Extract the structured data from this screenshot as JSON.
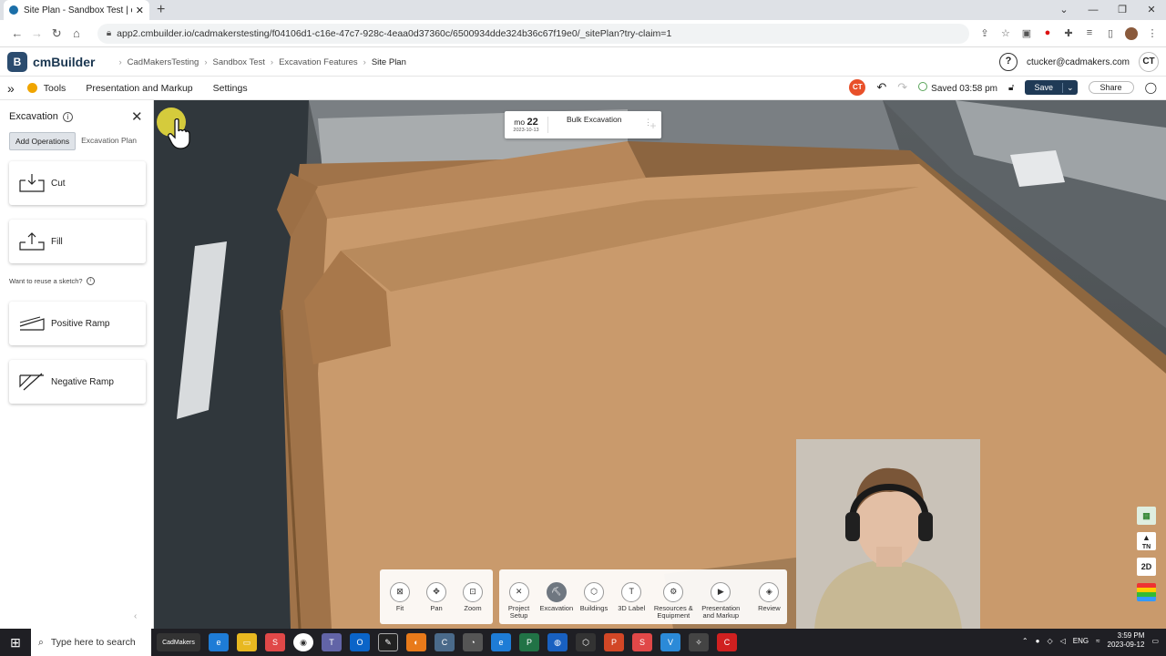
{
  "browser": {
    "tab_title": "Site Plan - Sandbox Test | cmBuil",
    "url": "app2.cmbuilder.io/cadmakerstesting/f04106d1-c16e-47c7-928c-4eaa0d37360c/6500934dde324b36c67f19e0/_sitePlan?try-claim=1"
  },
  "app": {
    "logo_text": "cmBuilder",
    "logo_mark": "B",
    "breadcrumbs": [
      "CadMakersTesting",
      "Sandbox Test",
      "Excavation Features",
      "Site Plan"
    ],
    "help_symbol": "?",
    "user_email": "ctucker@cadmakers.com",
    "user_initials": "CT"
  },
  "toolbar": {
    "tools_label": "Tools",
    "presentation_label": "Presentation and Markup",
    "settings_label": "Settings",
    "user_badge": "CT",
    "saved_status": "Saved 03:58 pm",
    "save_label": "Save",
    "share_label": "Share"
  },
  "sidebar": {
    "title": "Excavation",
    "tabs": [
      "Add Operations",
      "Excavation Plan"
    ],
    "operations": [
      {
        "label": "Cut",
        "icon": "cut-icon"
      },
      {
        "label": "Fill",
        "icon": "fill-icon"
      }
    ],
    "reuse_text": "Want to reuse a sketch?",
    "ramps": [
      {
        "label": "Positive Ramp",
        "icon": "positive-ramp-icon"
      },
      {
        "label": "Negative Ramp",
        "icon": "negative-ramp-icon"
      }
    ]
  },
  "timeline": {
    "weekday": "mo",
    "day": "22",
    "date": "2023-10-13",
    "phase": "Bulk Excavation"
  },
  "view_controls": [
    {
      "label": "Fit",
      "icon": "fit-icon"
    },
    {
      "label": "Pan",
      "icon": "pan-icon"
    },
    {
      "label": "Zoom",
      "icon": "zoom-icon"
    }
  ],
  "main_tools": [
    {
      "label": "Project\nSetup",
      "icon": "project-setup-icon",
      "active": false
    },
    {
      "label": "Excavation",
      "icon": "excavation-icon",
      "active": true
    },
    {
      "label": "Buildings",
      "icon": "buildings-icon",
      "active": false
    },
    {
      "label": "3D Label",
      "icon": "3d-label-icon",
      "active": false
    },
    {
      "label": "Resources &\nEquipment",
      "icon": "resources-icon",
      "active": false
    },
    {
      "label": "Presentation\nand Markup",
      "icon": "presentation-icon",
      "active": false
    },
    {
      "label": "Review",
      "icon": "review-icon",
      "active": false
    }
  ],
  "map_controls": {
    "north_label": "TN",
    "view_mode": "2D"
  },
  "taskbar": {
    "search_placeholder": "Type here to search",
    "pinned_app": "CadMakers",
    "language": "ENG",
    "time": "3:59 PM",
    "date": "2023-09-12"
  },
  "colors": {
    "brand_navy": "#1f3a56",
    "user_badge": "#e8502a",
    "excavation_surface": "#c99a6c",
    "taskbar": "#1f1f24"
  }
}
